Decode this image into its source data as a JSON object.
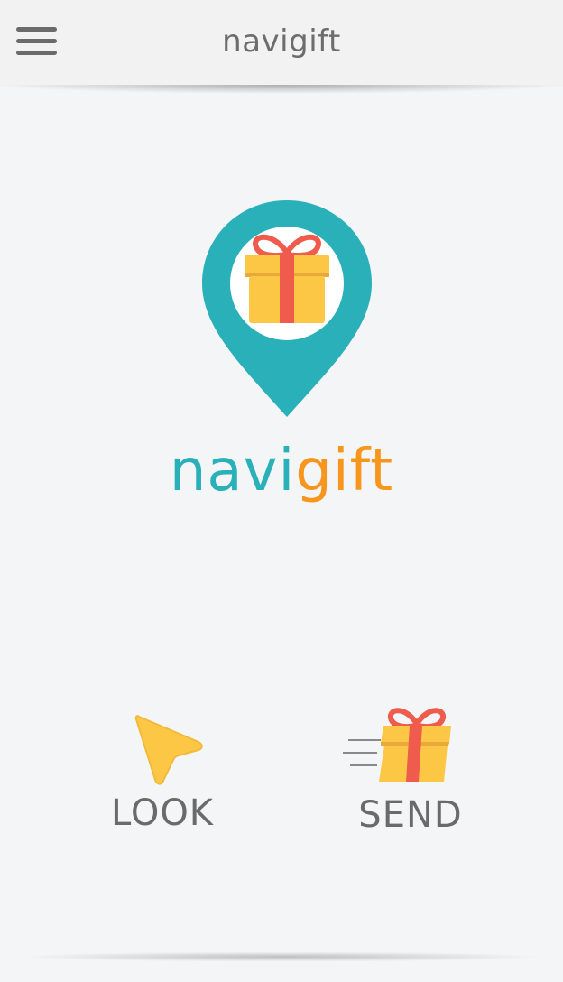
{
  "appbar": {
    "title": "navigift",
    "menu_icon": "hamburger-menu-icon"
  },
  "logo": {
    "text_part1": "navi",
    "text_part2": "gift",
    "pin_icon": "map-pin-gift-icon",
    "colors": {
      "teal": "#2ab0b9",
      "orange": "#f7961d",
      "gift_yellow": "#fcc745",
      "ribbon_red": "#ef5b4c"
    }
  },
  "actions": {
    "look": {
      "label": "LOOK",
      "icon": "cursor-arrow-icon"
    },
    "send": {
      "label": "SEND",
      "icon": "flying-gift-icon"
    }
  }
}
